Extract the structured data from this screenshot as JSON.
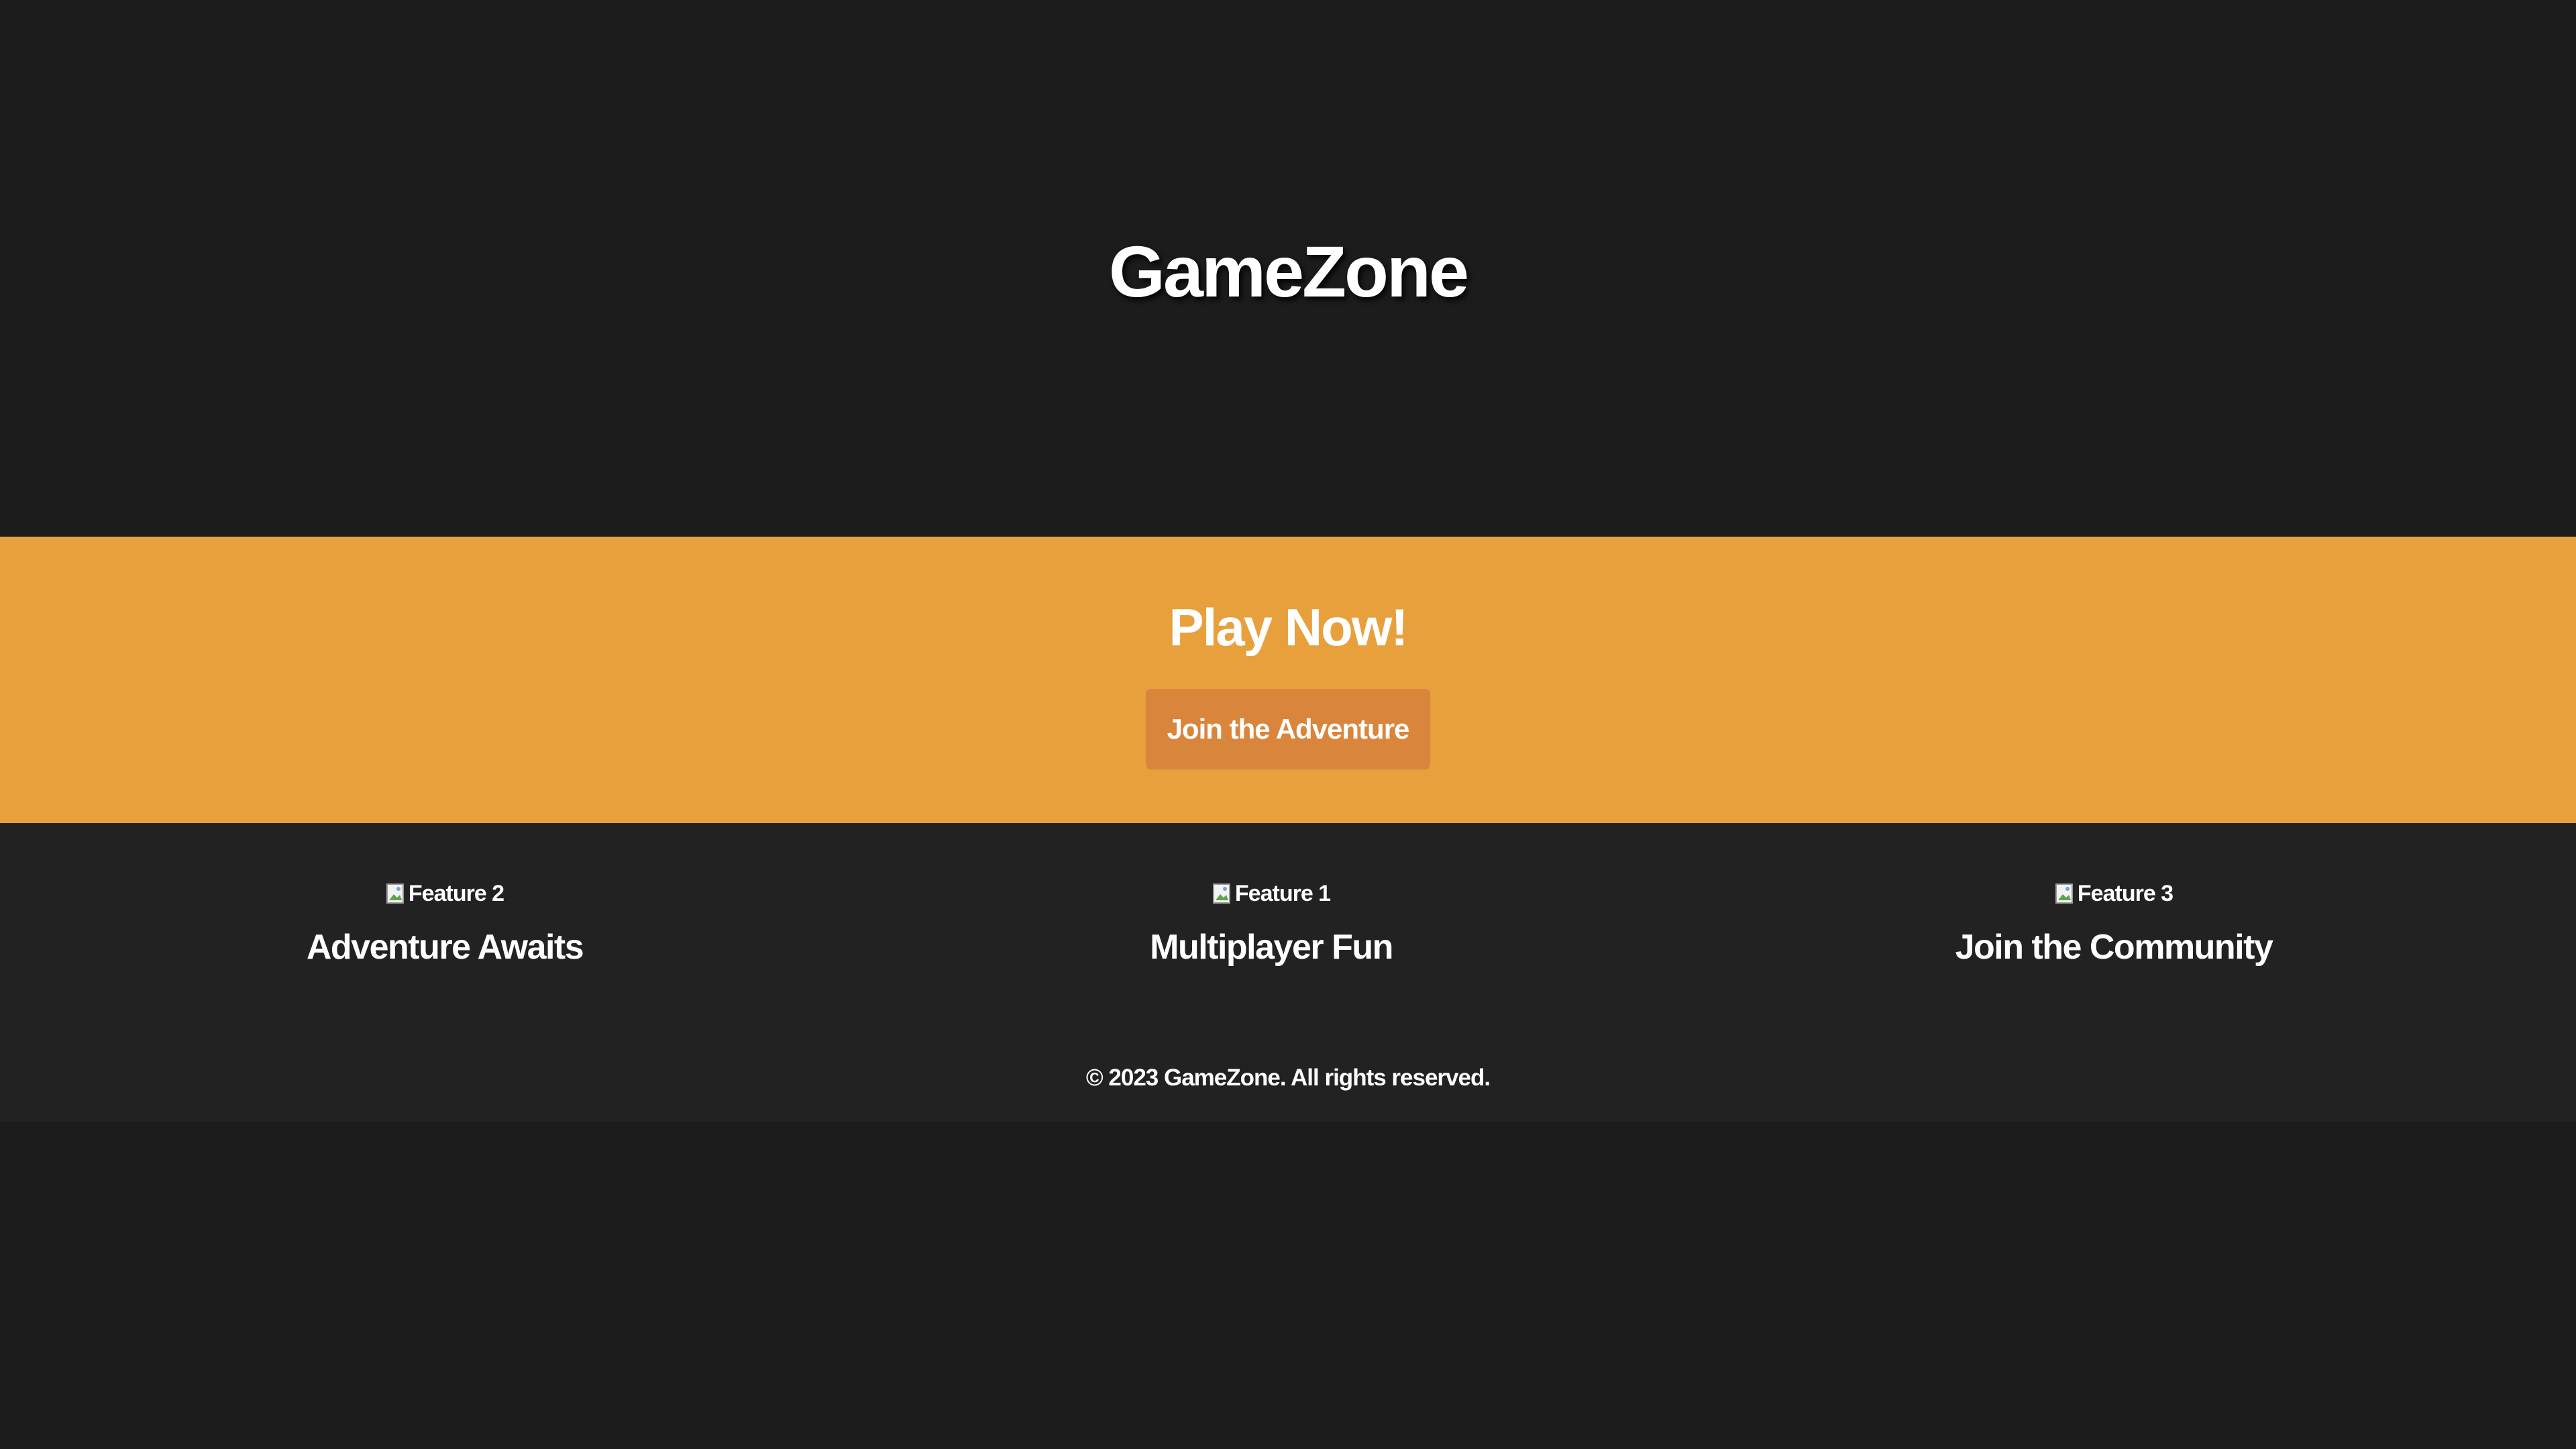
{
  "hero": {
    "title": "GameZone"
  },
  "cta": {
    "title": "Play Now!",
    "button_label": "Join the Adventure"
  },
  "features": [
    {
      "image_alt": "Feature 2",
      "title": "Adventure Awaits"
    },
    {
      "image_alt": "Feature 1",
      "title": "Multiplayer Fun"
    },
    {
      "image_alt": "Feature 3",
      "title": "Join the Community"
    }
  ],
  "footer": {
    "text": "© 2023 GameZone. All rights reserved."
  },
  "colors": {
    "background": "#1c1c1c",
    "cta_background": "#e8a03c",
    "button_background": "#d9853b",
    "features_background": "#222222",
    "text": "#ffffff"
  }
}
